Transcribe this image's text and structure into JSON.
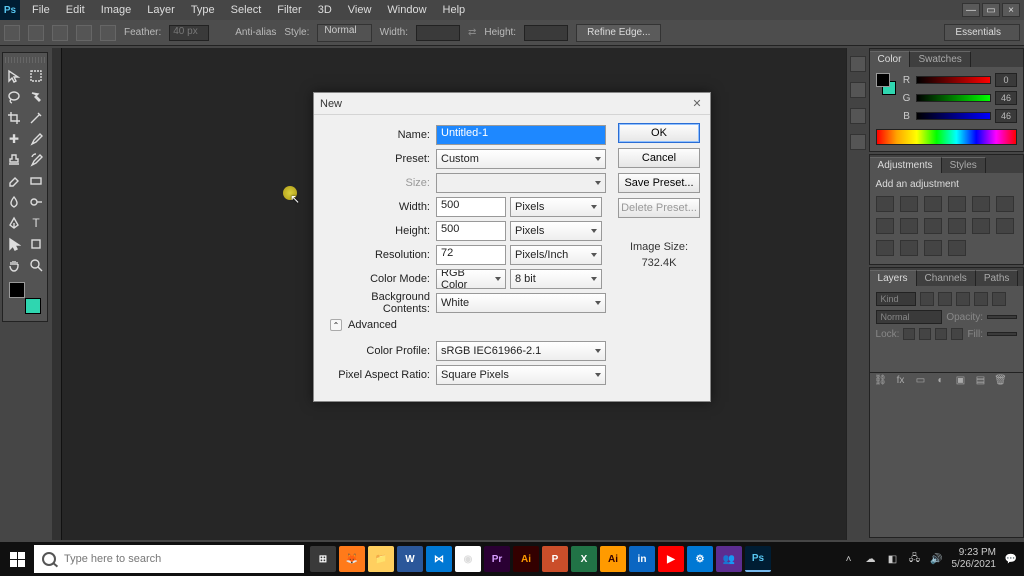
{
  "menu": [
    "File",
    "Edit",
    "Image",
    "Layer",
    "Type",
    "Select",
    "Filter",
    "3D",
    "View",
    "Window",
    "Help"
  ],
  "options_bar": {
    "feather_label": "Feather:",
    "feather_value": "40 px",
    "anti_alias": "Anti-alias",
    "style_label": "Style:",
    "style_value": "Normal",
    "width_label": "Width:",
    "height_label": "Height:",
    "refine": "Refine Edge...",
    "workspace": "Essentials"
  },
  "dialog": {
    "title": "New",
    "name_label": "Name:",
    "name_value": "Untitled-1",
    "preset_label": "Preset:",
    "preset_value": "Custom",
    "size_label": "Size:",
    "width_label": "Width:",
    "width_value": "500",
    "width_unit": "Pixels",
    "height_label": "Height:",
    "height_value": "500",
    "height_unit": "Pixels",
    "resolution_label": "Resolution:",
    "resolution_value": "72",
    "resolution_unit": "Pixels/Inch",
    "color_mode_label": "Color Mode:",
    "color_mode_value": "RGB Color",
    "color_depth": "8 bit",
    "bg_contents_label": "Background Contents:",
    "bg_contents_value": "White",
    "advanced": "Advanced",
    "color_profile_label": "Color Profile:",
    "color_profile_value": "sRGB IEC61966-2.1",
    "pixel_aspect_label": "Pixel Aspect Ratio:",
    "pixel_aspect_value": "Square Pixels",
    "ok": "OK",
    "cancel": "Cancel",
    "save_preset": "Save Preset...",
    "delete_preset": "Delete Preset...",
    "image_size_label": "Image Size:",
    "image_size_value": "732.4K"
  },
  "panels": {
    "color_tab": "Color",
    "swatches_tab": "Swatches",
    "sliders": [
      {
        "label": "R",
        "value": "0"
      },
      {
        "label": "G",
        "value": "46"
      },
      {
        "label": "B",
        "value": "46"
      }
    ],
    "adjustments_tab": "Adjustments",
    "styles_tab": "Styles",
    "add_adjustment": "Add an adjustment",
    "layers_tab": "Layers",
    "channels_tab": "Channels",
    "paths_tab": "Paths",
    "kind": "Kind",
    "blend_mode": "Normal",
    "opacity_label": "Opacity:",
    "lock_label": "Lock:",
    "fill_label": "Fill:"
  },
  "taskbar": {
    "search_placeholder": "Type here to search",
    "time": "9:23 PM",
    "date": "5/26/2021"
  }
}
